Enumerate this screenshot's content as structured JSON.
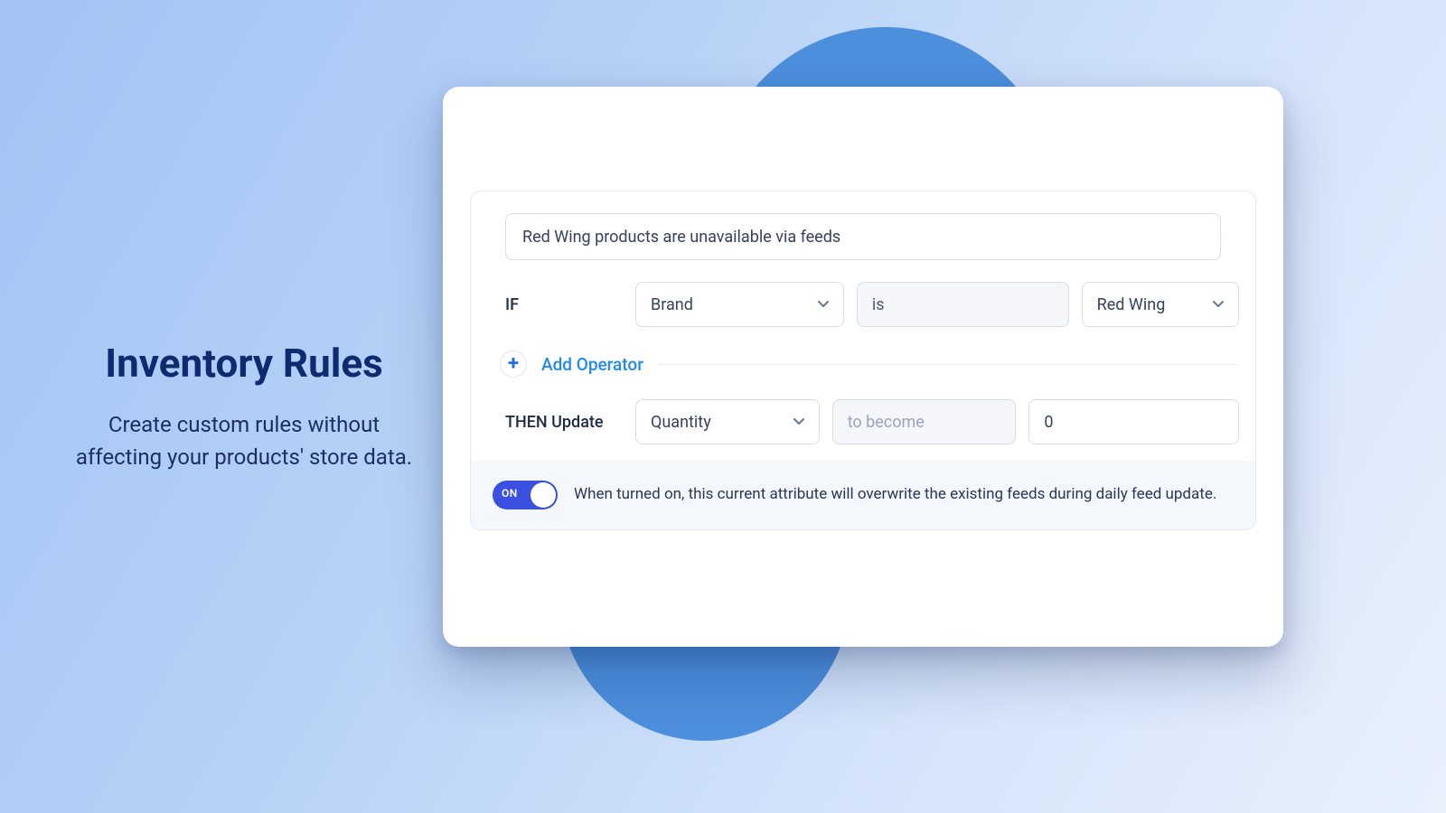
{
  "hero": {
    "title": "Inventory Rules",
    "subtitle": "Create custom rules without affecting your products' store data."
  },
  "rule": {
    "name": "Red Wing products are unavailable via feeds",
    "if_label": "IF",
    "if_field": "Brand",
    "if_operator": "is",
    "if_value": "Red Wing",
    "add_operator_label": "Add Operator",
    "then_label": "THEN Update",
    "then_field": "Quantity",
    "then_operator_placeholder": "to become",
    "then_value": "0"
  },
  "toggle": {
    "state_label": "ON",
    "description": "When turned on, this current attribute will overwrite the existing feeds during daily feed update."
  }
}
